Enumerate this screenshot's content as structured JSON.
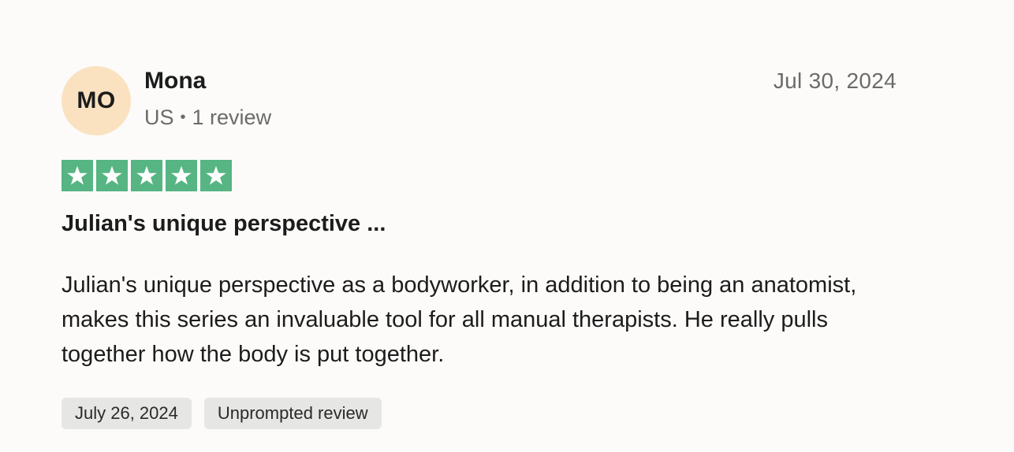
{
  "reviewer": {
    "initials": "MO",
    "name": "Mona",
    "country": "US",
    "separator": "•",
    "review_count": "1 review"
  },
  "review": {
    "posted_date": "Jul 30, 2024",
    "rating": 5,
    "rating_max": 5,
    "star_color": "#56b583",
    "title": "Julian's unique perspective ...",
    "body": "Julian's unique perspective as a bodyworker, in addition to being an anatomist, makes this series an invaluable tool for all manual therapists. He really pulls together how the body is put together.",
    "experience_date": "July 26, 2024",
    "label": "Unprompted review"
  },
  "colors": {
    "avatar_bg": "#fae2c0",
    "page_bg": "#fcfbf9",
    "tag_bg": "#e6e6e4"
  }
}
